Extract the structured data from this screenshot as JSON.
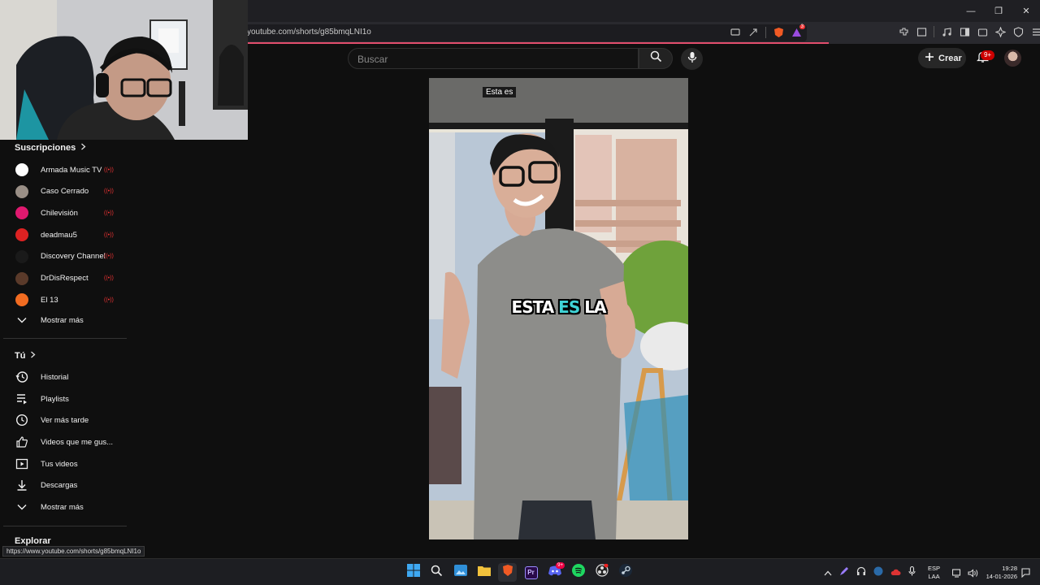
{
  "browser": {
    "url": "youtube.com/shorts/g85bmqLNI1o",
    "status_url": "https://www.youtube.com/shorts/g85bmqLNI1o",
    "tab_badge": "3"
  },
  "header": {
    "search_placeholder": "Buscar",
    "create_label": "Crear",
    "notifications_count": "9+"
  },
  "sidebar": {
    "subscriptions_title": "Suscripciones",
    "subscriptions": [
      {
        "name": "Armada Music TV",
        "live": true,
        "color": "#ffffff"
      },
      {
        "name": "Caso Cerrado",
        "live": true,
        "color": "#9a8f86"
      },
      {
        "name": "Chilevisión",
        "live": true,
        "color": "#e0196f"
      },
      {
        "name": "deadmau5",
        "live": true,
        "color": "#d22"
      },
      {
        "name": "Discovery Channel",
        "live": true,
        "color": "#1a1a1a"
      },
      {
        "name": "DrDisRespect",
        "live": true,
        "color": "#5a3a2a"
      },
      {
        "name": "El 13",
        "live": true,
        "color": "#f26c21"
      }
    ],
    "show_more_1": "Mostrar más",
    "you_title": "Tú",
    "you_items": [
      {
        "label": "Historial",
        "icon": "history-icon"
      },
      {
        "label": "Playlists",
        "icon": "playlists-icon"
      },
      {
        "label": "Ver más tarde",
        "icon": "watch-later-icon"
      },
      {
        "label": "Videos que me gus...",
        "icon": "like-icon"
      },
      {
        "label": "Tus videos",
        "icon": "your-videos-icon"
      },
      {
        "label": "Descargas",
        "icon": "download-icon"
      }
    ],
    "show_more_2": "Mostrar más",
    "explore_title": "Explorar"
  },
  "video": {
    "caption": "Esta es",
    "subtitle_words": [
      "ESTA",
      "ES",
      "LA"
    ]
  },
  "taskbar": {
    "language": "ESP",
    "keyboard": "LAA",
    "time": "19:28",
    "date": "14-01-2026",
    "discord_badge": "9+"
  },
  "colors": {
    "accent_red": "#cc0000",
    "subtitle_highlight": "#3fd3d6"
  }
}
